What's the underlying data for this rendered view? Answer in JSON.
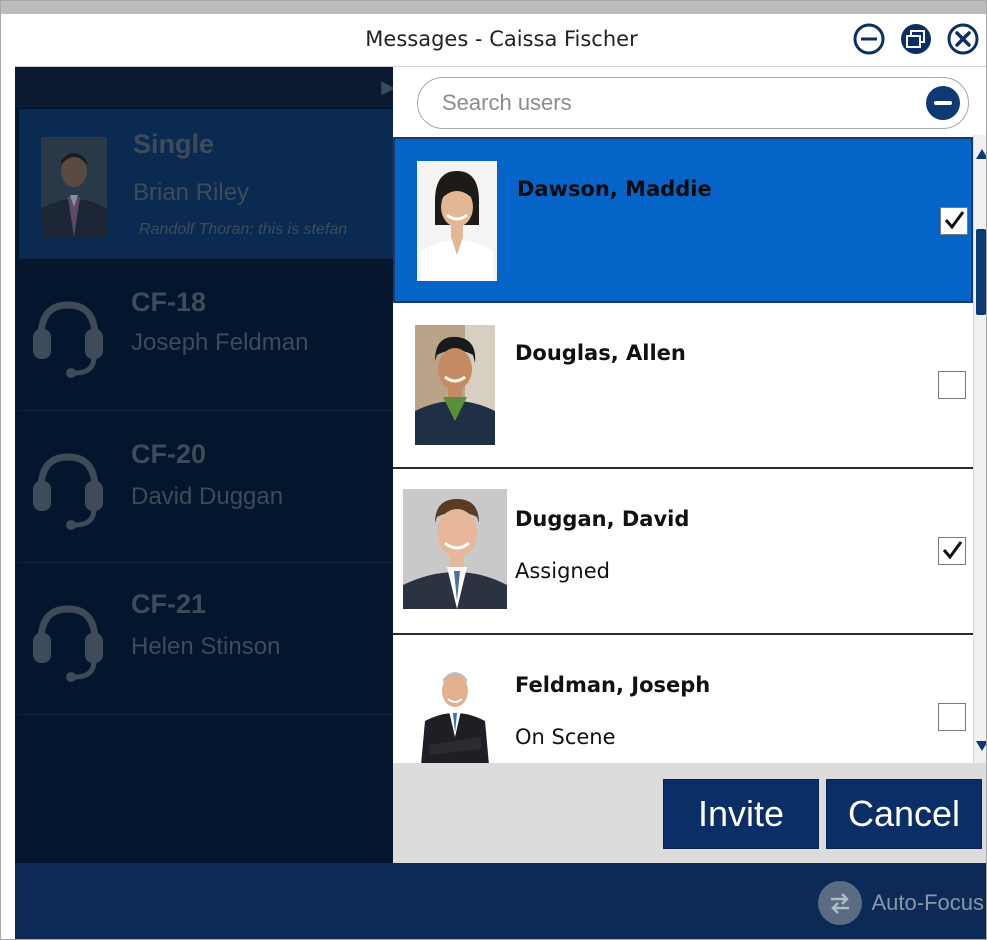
{
  "window": {
    "title": "Messages - Caissa Fischer"
  },
  "conversations": [
    {
      "name": "Single",
      "participant": "Brian Riley",
      "last_message": "Randolf Thoran: this is stefan",
      "avatar": "photo"
    },
    {
      "name": "CF-18",
      "participant": "Joseph Feldman",
      "avatar": "headset-icon"
    },
    {
      "name": "CF-20",
      "participant": "David Duggan",
      "avatar": "headset-icon"
    },
    {
      "name": "CF-21",
      "participant": "Helen Stinson",
      "avatar": "headset-icon"
    }
  ],
  "search": {
    "placeholder": "Search users"
  },
  "users": [
    {
      "name": "Dawson, Maddie",
      "status": "",
      "checked": true,
      "selected": true
    },
    {
      "name": "Douglas, Allen",
      "status": "",
      "checked": false,
      "selected": false
    },
    {
      "name": "Duggan, David",
      "status": "Assigned",
      "checked": true,
      "selected": false
    },
    {
      "name": "Feldman, Joseph",
      "status": "On Scene",
      "checked": false,
      "selected": false
    }
  ],
  "actions": {
    "invite_label": "Invite",
    "cancel_label": "Cancel"
  },
  "footer": {
    "autofocus_label": "Auto-Focus"
  },
  "colors": {
    "accent": "#0b2e66",
    "selected_row": "#0564c8",
    "sidebar_bg": "#03162d",
    "footer_bg": "#0c2a56"
  },
  "scroll_position": 0.18
}
